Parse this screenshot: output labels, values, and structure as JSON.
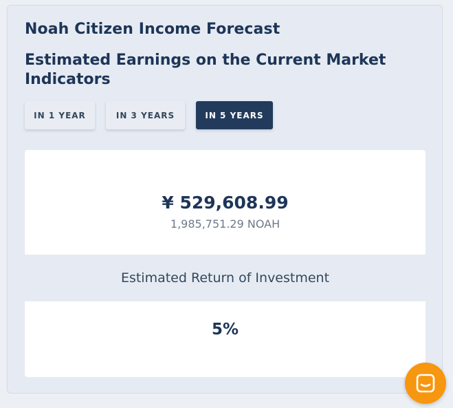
{
  "card": {
    "title": "Noah Citizen Income Forecast",
    "subtitle": "Estimated Earnings on the Current Market Indicators"
  },
  "tabs": [
    {
      "label": "IN 1 YEAR",
      "active": false
    },
    {
      "label": "IN 3 YEARS",
      "active": false
    },
    {
      "label": "IN 5 YEARS",
      "active": true
    }
  ],
  "forecast": {
    "amount": "¥ 529,608.99",
    "token_amount": "1,985,751.29 NOAH",
    "roi_label": "Estimated Return of Investment",
    "roi_value": "5%"
  },
  "chat": {
    "icon": "chat-bubble-icon",
    "color": "#f7960f"
  },
  "colors": {
    "accent": "#223b5c",
    "heading": "#1d3557",
    "card_bg": "#e6ebf3",
    "chat": "#f7960f"
  }
}
